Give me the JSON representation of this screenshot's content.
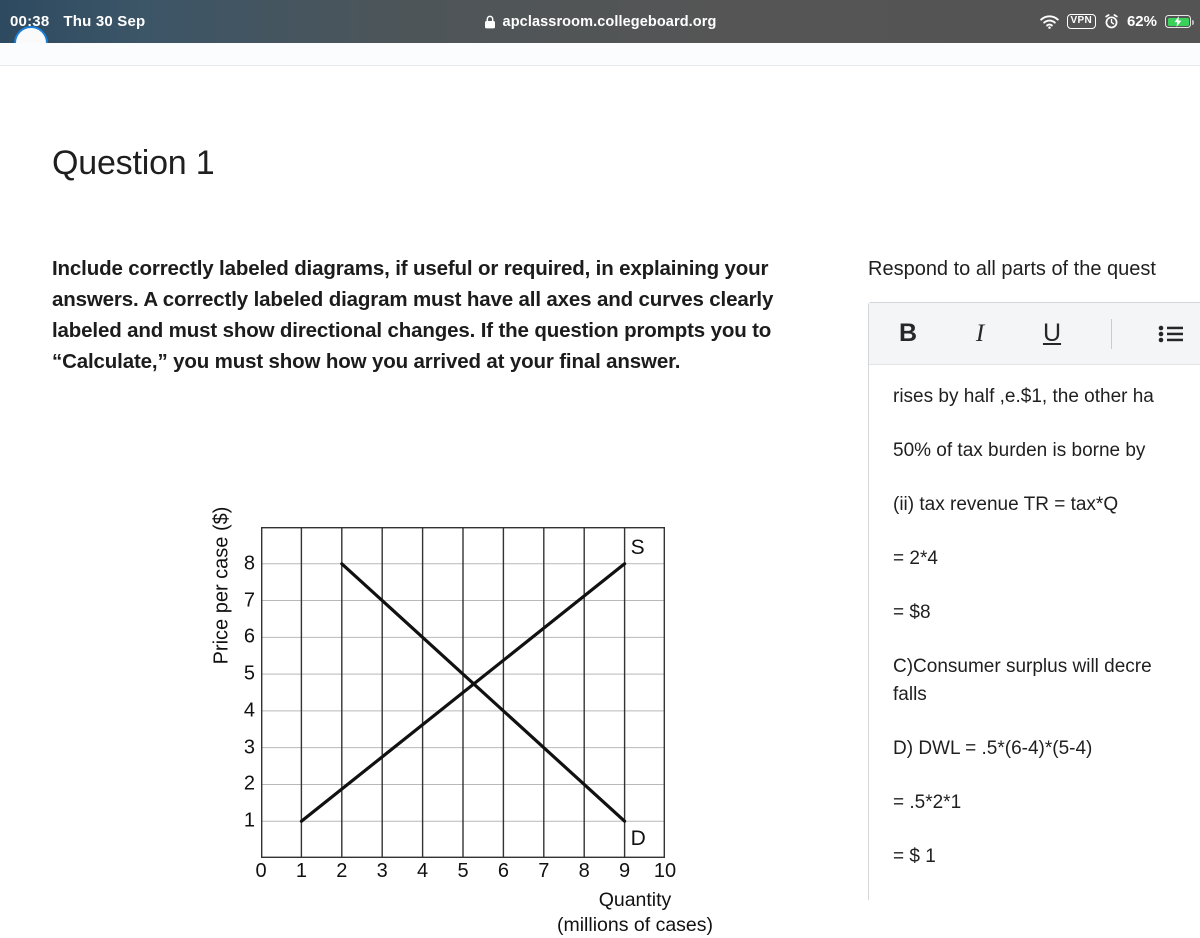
{
  "statusbar": {
    "time": "00:38",
    "date": "Thu 30 Sep",
    "url": "apclassroom.collegeboard.org",
    "lock_icon": "lock-icon",
    "wifi_icon": "wifi-icon",
    "vpn_badge": "VPN",
    "alarm_icon": "alarm-clock-icon",
    "battery_percent": "62%",
    "battery_icon": "battery-charging-icon",
    "accent_blue": "#1a7fd4",
    "battery_green": "#39d15a"
  },
  "left": {
    "title": "Question 1",
    "directions": "Include correctly labeled diagrams, if useful or required, in explaining your answers. A correctly labeled diagram must have all axes and curves clearly labeled and must show directional changes. If the question prompts you to “Calculate,” you must show how you arrived at your final answer."
  },
  "chart_data": {
    "type": "line",
    "title": "",
    "xlabel": "Quantity",
    "xlabel_sub": "(millions of cases)",
    "ylabel": "Price per case ($)",
    "xlim": [
      0,
      10
    ],
    "ylim": [
      0,
      9
    ],
    "xticks": [
      0,
      1,
      2,
      3,
      4,
      5,
      6,
      7,
      8,
      9,
      10
    ],
    "yticks": [
      1,
      2,
      3,
      4,
      5,
      6,
      7,
      8
    ],
    "grid": true,
    "legend_position": "inline-curve-labels",
    "equilibrium": {
      "quantity": 5,
      "price": 5
    },
    "series": [
      {
        "name": "S",
        "label": "S",
        "description": "Supply curve",
        "points": [
          [
            1,
            1
          ],
          [
            9,
            8
          ]
        ],
        "color": "#111111"
      },
      {
        "name": "D",
        "label": "D",
        "description": "Demand curve",
        "points": [
          [
            2,
            8
          ],
          [
            9,
            1
          ]
        ],
        "color": "#111111"
      }
    ]
  },
  "right": {
    "respond_prompt": "Respond to all parts of the quest",
    "toolbar": {
      "bold_label": "B",
      "italic_label": "I",
      "underline_label": "U",
      "bullet_list_icon": "bulleted-list-icon",
      "numbered_list_icon": "numbered-list-icon"
    },
    "answer_paragraphs": [
      "rises by half ,e.$1, the other ha",
      "50% of tax burden is borne by",
      "(ii) tax revenue TR = tax*Q",
      "= 2*4",
      "= $8",
      "C)Consumer surplus will decre",
      "falls",
      "D) DWL = .5*(6-4)*(5-4)",
      "= .5*2*1",
      "= $ 1"
    ]
  }
}
